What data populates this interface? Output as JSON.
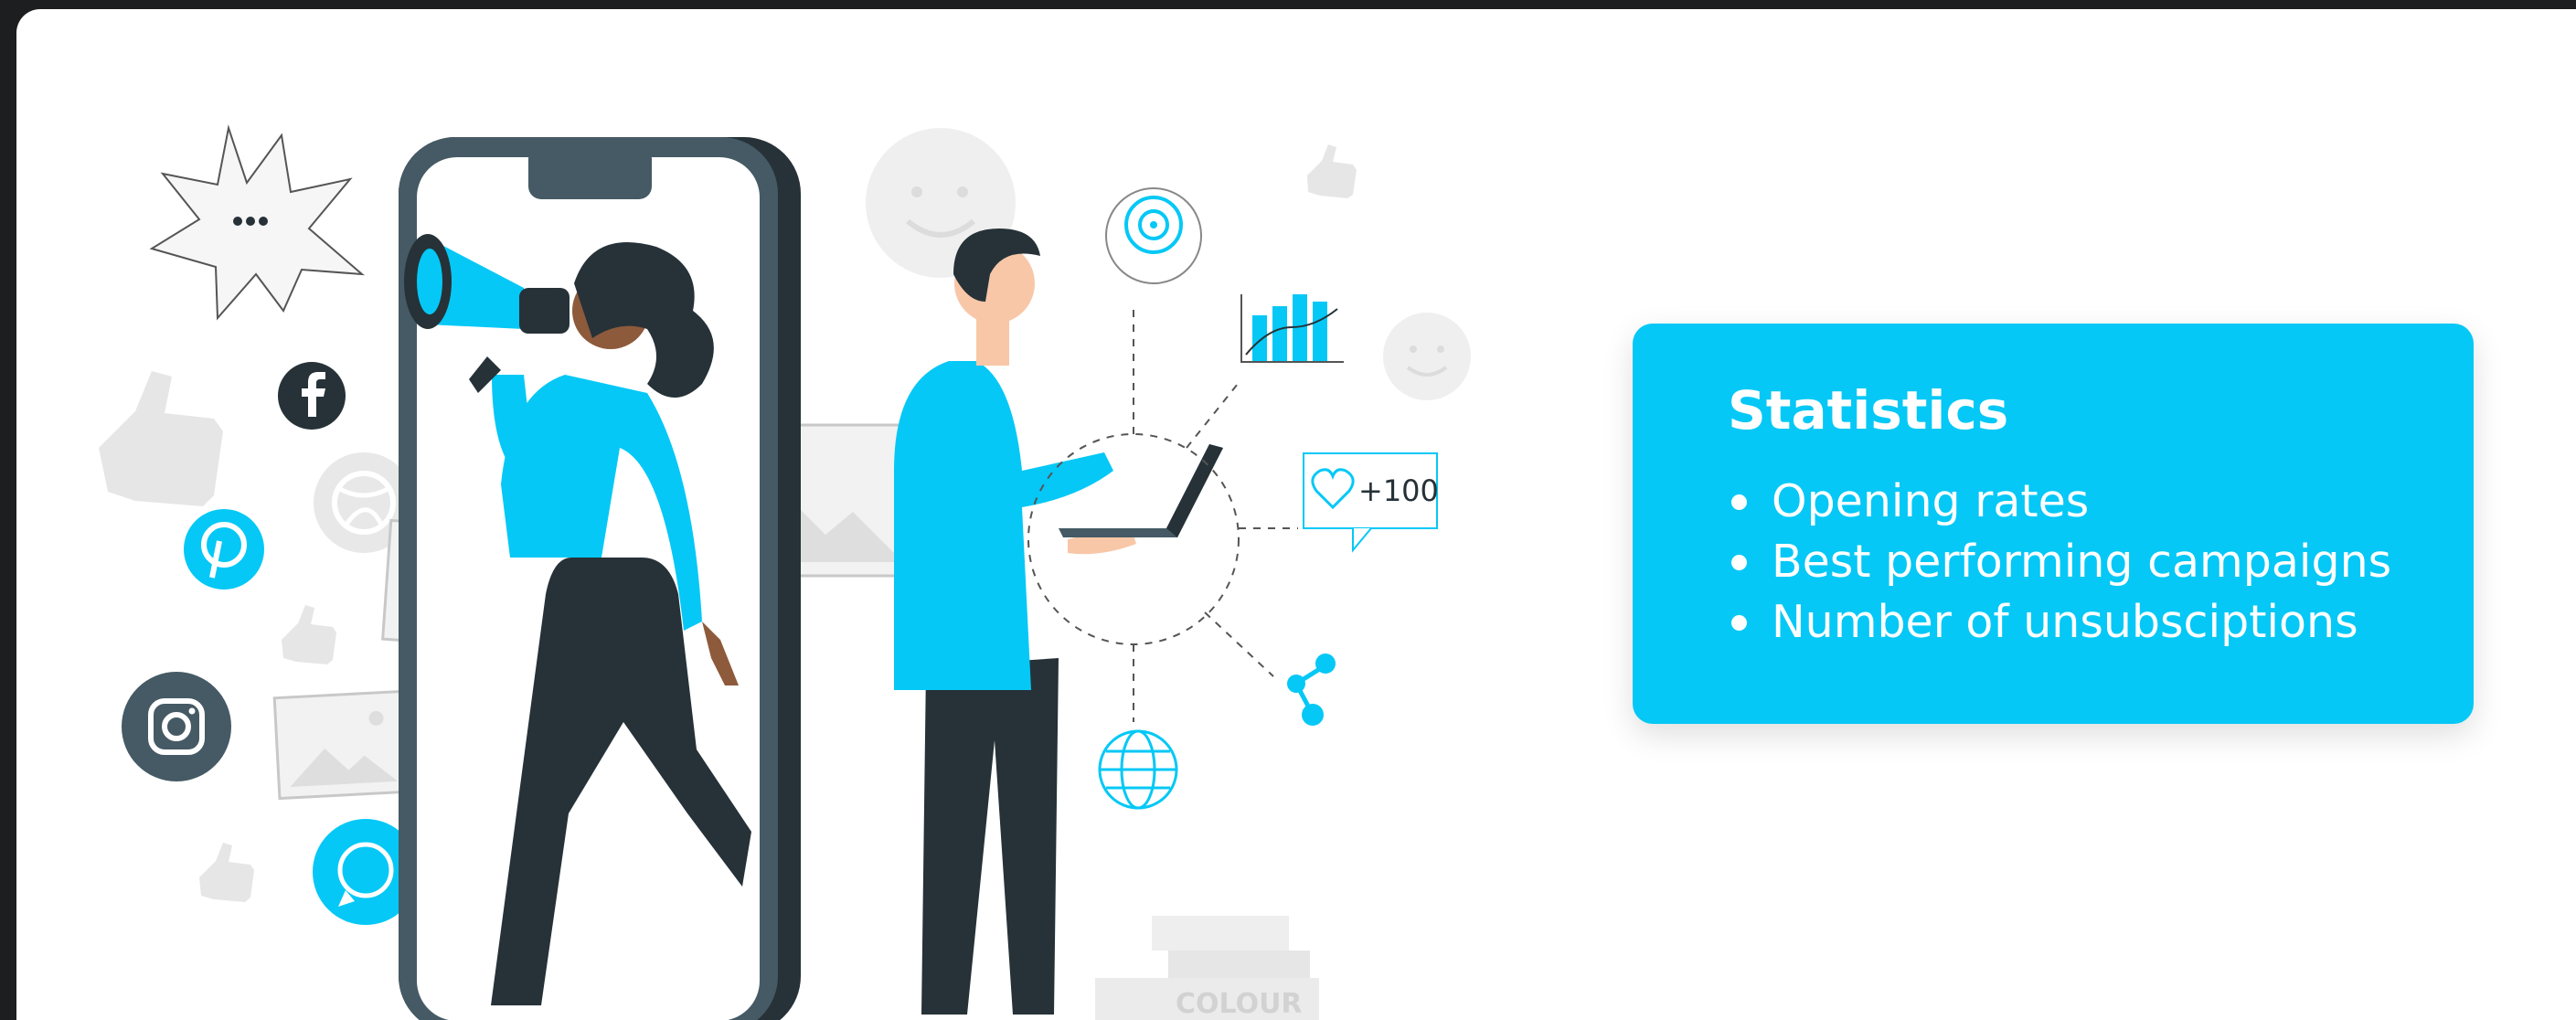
{
  "colors": {
    "accent": "#05c8f6",
    "dark": "#263238",
    "background": "#ffffff",
    "frame": "#1d1e20"
  },
  "card": {
    "title": "Statistics",
    "items": [
      "Opening rates",
      "Best performing campaigns",
      "Number of unsubsciptions"
    ]
  },
  "illustration": {
    "notification_label": "+100",
    "book_label": "COLOUR",
    "icons": [
      "speech-burst-icon",
      "facebook-icon",
      "pinterest-icon",
      "instagram-icon",
      "whatsapp-icon",
      "dribbble-icon",
      "thumbs-up-icon",
      "target-icon",
      "bar-chart-icon",
      "heart-icon",
      "share-icon",
      "globe-icon",
      "smiley-icon",
      "image-placeholder-icon",
      "megaphone-icon",
      "laptop-icon"
    ]
  }
}
